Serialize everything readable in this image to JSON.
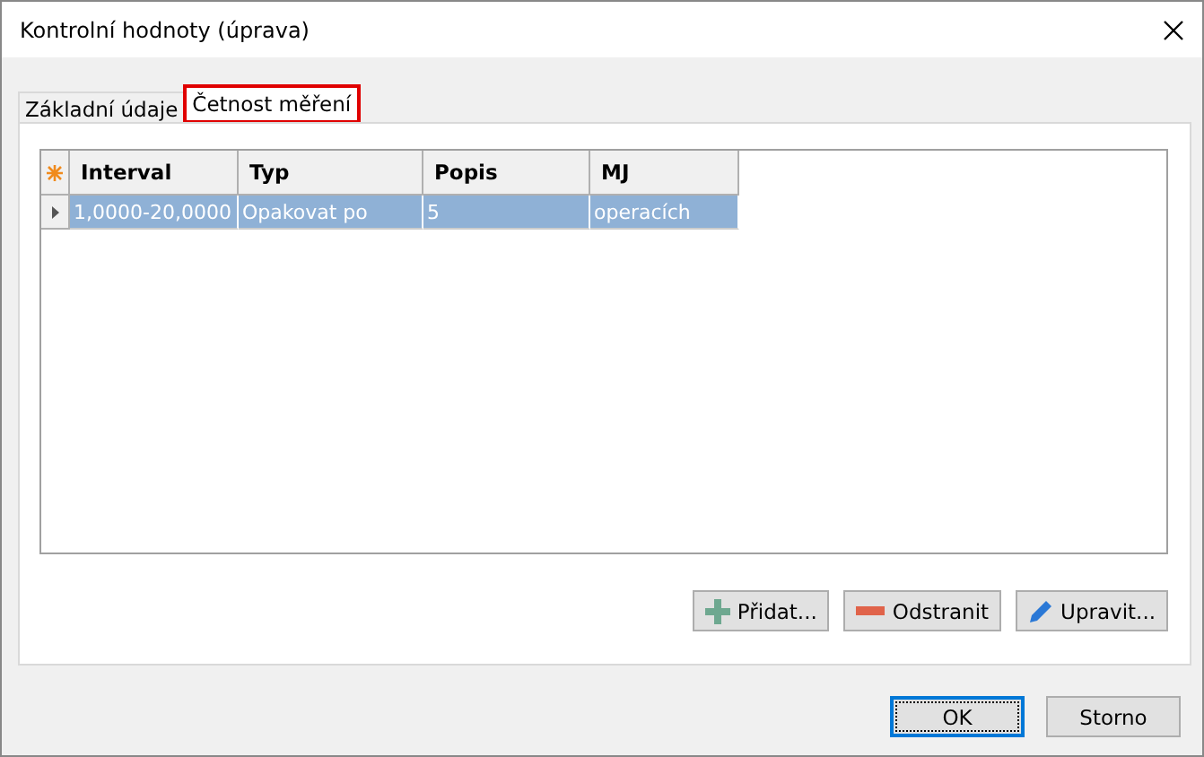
{
  "window": {
    "title": "Kontrolní hodnoty (úprava)"
  },
  "tabs": [
    {
      "label": "Základní údaje",
      "selected": false
    },
    {
      "label": "Četnost měření",
      "selected": true
    }
  ],
  "table": {
    "columns": [
      "Interval",
      "Typ",
      "Popis",
      "MJ"
    ],
    "rows": [
      {
        "cells": [
          "1,0000-20,0000",
          "Opakovat po",
          "5",
          "operacích"
        ],
        "selected": true
      }
    ]
  },
  "actions": [
    {
      "label": "Přidat...",
      "kind": "add"
    },
    {
      "label": "Odstranit",
      "kind": "remove"
    },
    {
      "label": "Upravit...",
      "kind": "edit"
    }
  ],
  "buttons": [
    {
      "label": "OK",
      "selected": true
    },
    {
      "label": "Storno",
      "selected": false
    }
  ]
}
